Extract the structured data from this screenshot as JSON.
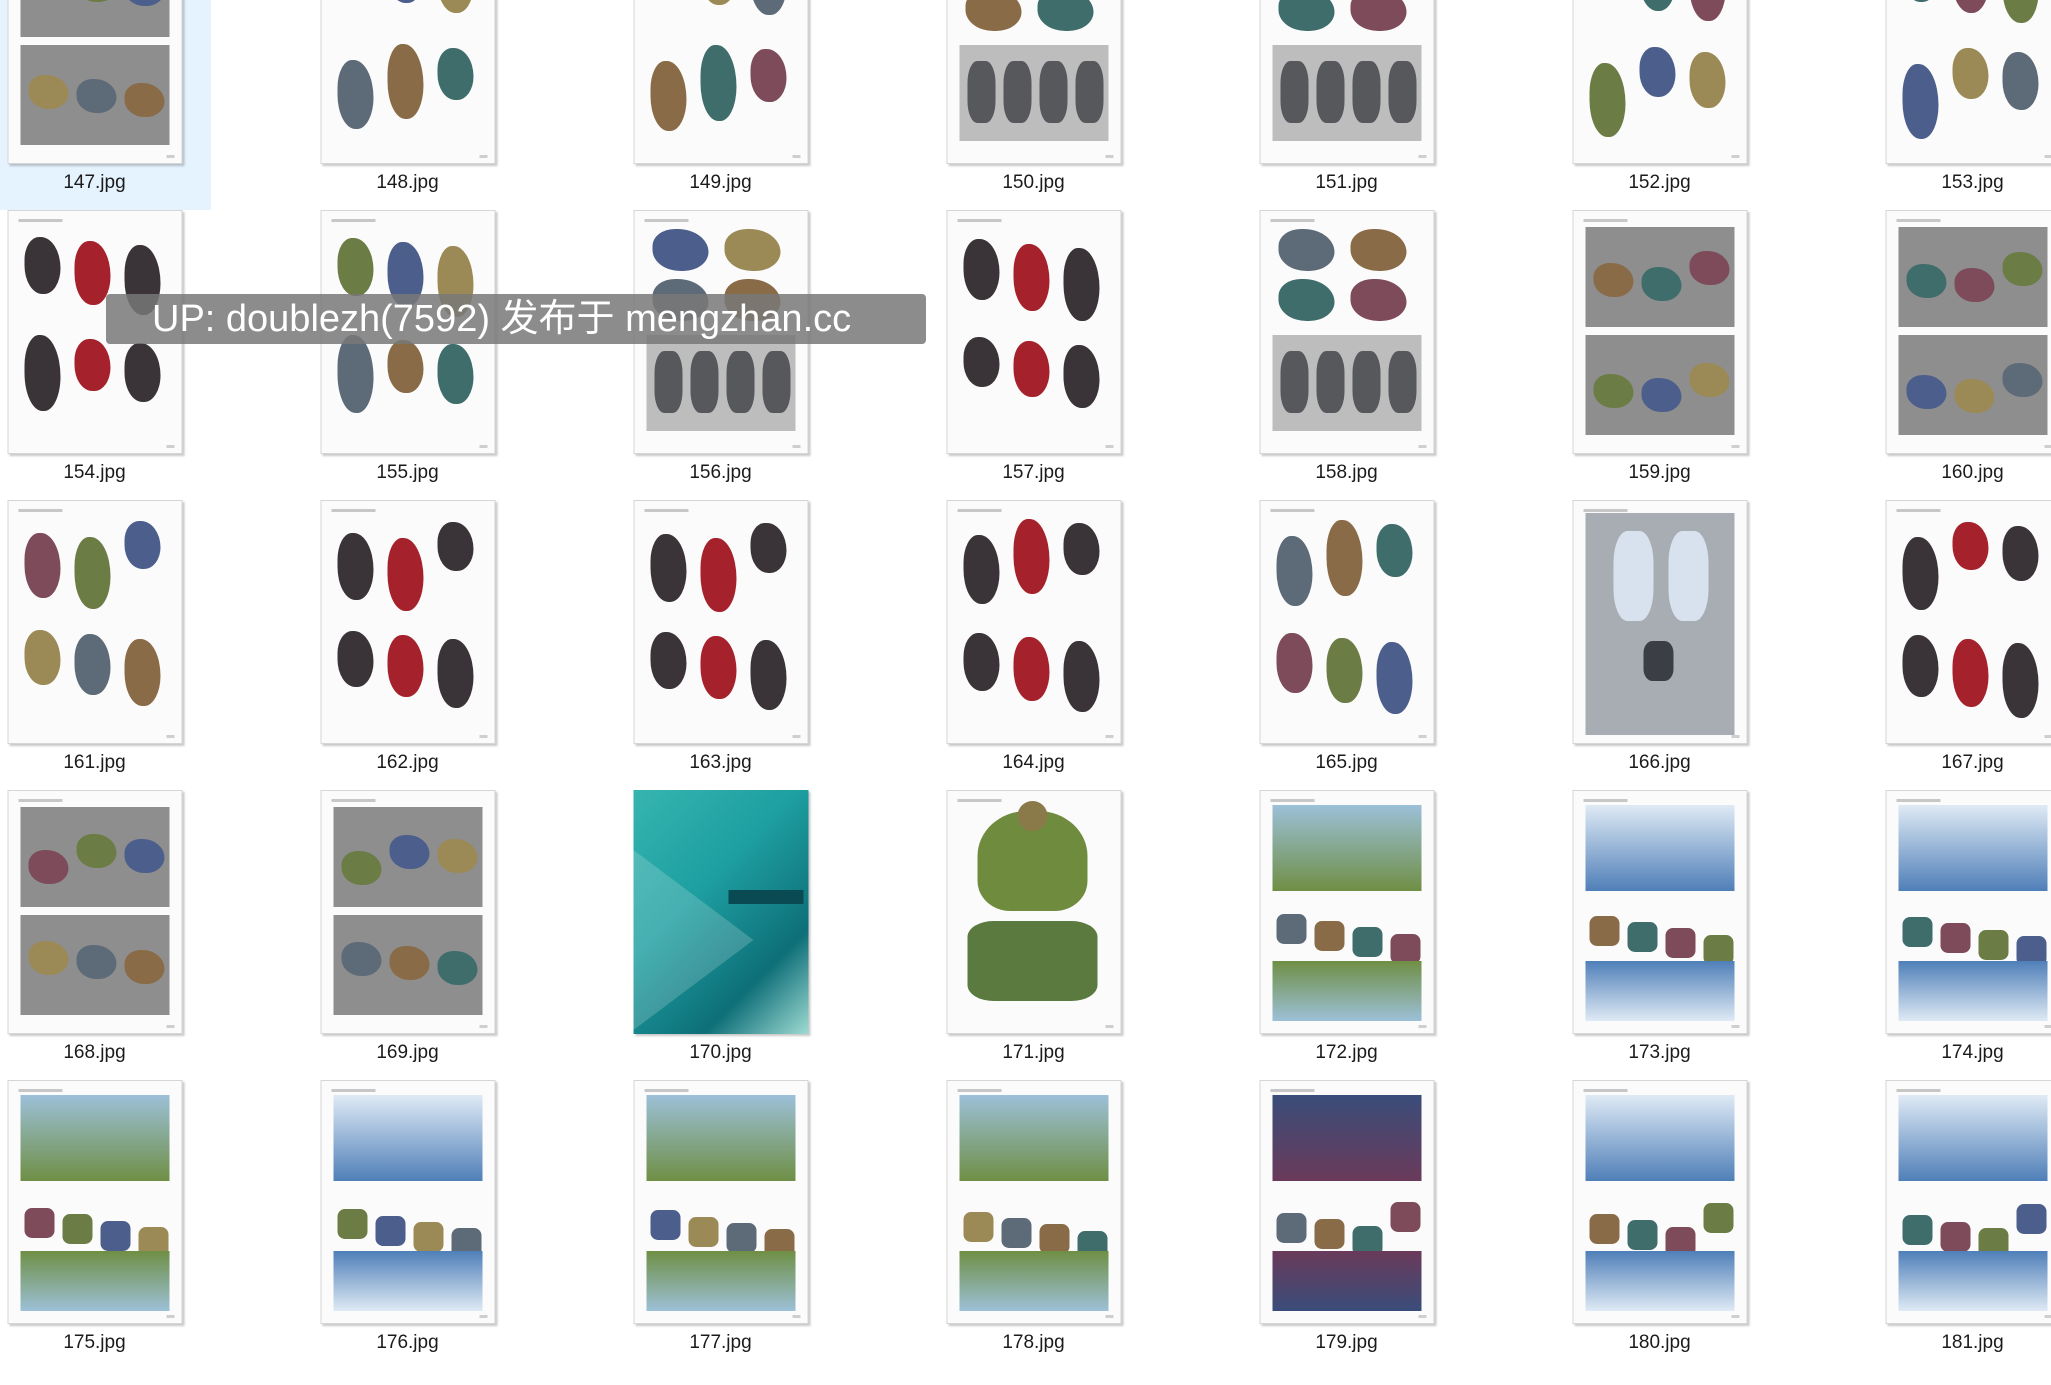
{
  "watermark": "UP: doublezh(7592) 发布于 mengzhan.cc",
  "selected": "147.jpg",
  "files": [
    {
      "name": "147.jpg",
      "style": "panels-gray"
    },
    {
      "name": "148.jpg",
      "style": "creatures-color"
    },
    {
      "name": "149.jpg",
      "style": "birds"
    },
    {
      "name": "150.jpg",
      "style": "beasts-panel"
    },
    {
      "name": "151.jpg",
      "style": "beasts-panel"
    },
    {
      "name": "152.jpg",
      "style": "creatures-color"
    },
    {
      "name": "153.jpg",
      "style": "creatures-color"
    },
    {
      "name": "154.jpg",
      "style": "creatures-dark"
    },
    {
      "name": "155.jpg",
      "style": "creatures-color"
    },
    {
      "name": "156.jpg",
      "style": "beasts-panel"
    },
    {
      "name": "157.jpg",
      "style": "creatures-dark"
    },
    {
      "name": "158.jpg",
      "style": "beasts-panel"
    },
    {
      "name": "159.jpg",
      "style": "panels-gray"
    },
    {
      "name": "160.jpg",
      "style": "panels-gray"
    },
    {
      "name": "161.jpg",
      "style": "creatures-color"
    },
    {
      "name": "162.jpg",
      "style": "creatures-dark"
    },
    {
      "name": "163.jpg",
      "style": "creatures-dark"
    },
    {
      "name": "164.jpg",
      "style": "creatures-dark"
    },
    {
      "name": "165.jpg",
      "style": "creatures-color"
    },
    {
      "name": "166.jpg",
      "style": "panel-tall"
    },
    {
      "name": "167.jpg",
      "style": "creatures-dark"
    },
    {
      "name": "168.jpg",
      "style": "panels-gray"
    },
    {
      "name": "169.jpg",
      "style": "panels-gray"
    },
    {
      "name": "170.jpg",
      "style": "cover"
    },
    {
      "name": "171.jpg",
      "style": "building"
    },
    {
      "name": "172.jpg",
      "style": "landscape"
    },
    {
      "name": "173.jpg",
      "style": "landscape-blue"
    },
    {
      "name": "174.jpg",
      "style": "landscape-blue"
    },
    {
      "name": "175.jpg",
      "style": "landscape"
    },
    {
      "name": "176.jpg",
      "style": "landscape-blue"
    },
    {
      "name": "177.jpg",
      "style": "landscape"
    },
    {
      "name": "178.jpg",
      "style": "landscape"
    },
    {
      "name": "179.jpg",
      "style": "landscape-dusk"
    },
    {
      "name": "180.jpg",
      "style": "landscape-blue"
    },
    {
      "name": "181.jpg",
      "style": "landscape-blue"
    }
  ],
  "palette": {
    "gray_panel": "#8e8e8e",
    "dark_creature": "#3a3438",
    "red_accent": "#a5222c",
    "teal_cover": "#1d9ea0",
    "sky_blue": "#4f7fb8",
    "green_field": "#6f8f45",
    "dusk": "#6a3a5a"
  }
}
